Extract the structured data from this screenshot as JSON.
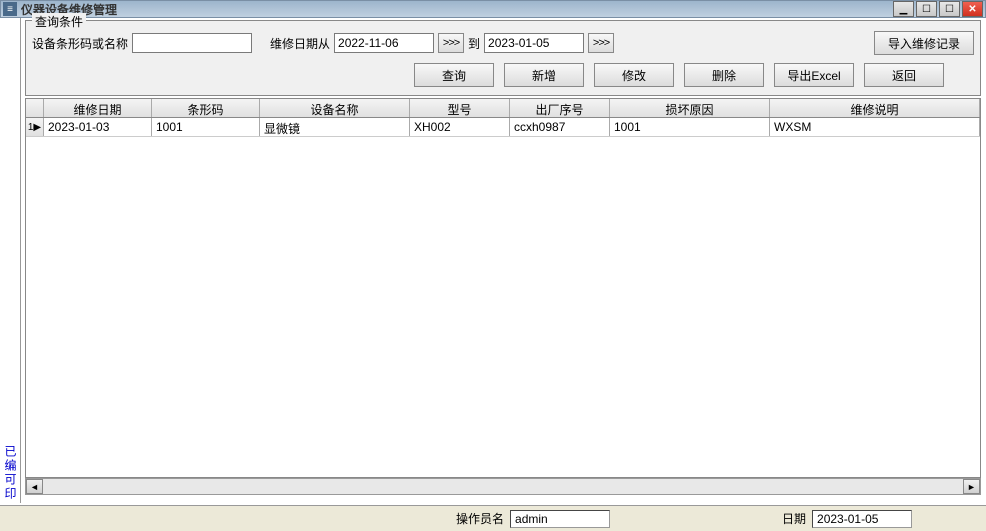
{
  "window": {
    "title": "仪器设备维修管理"
  },
  "query": {
    "legend": "查询条件",
    "barcode_label": "设备条形码或名称",
    "barcode_value": "",
    "date_from_label": "维修日期从",
    "date_from_value": "2022-11-06",
    "date_to_label": "到",
    "date_to_value": "2023-01-05",
    "picker_btn": ">>>",
    "import_btn": "导入维修记录"
  },
  "buttons": {
    "query": "查询",
    "add": "新增",
    "edit": "修改",
    "delete": "删除",
    "export": "导出Excel",
    "back": "返回"
  },
  "grid": {
    "row_num": "1",
    "row_marker": "▶",
    "headers": {
      "date": "维修日期",
      "barcode": "条形码",
      "name": "设备名称",
      "model": "型号",
      "serial": "出厂序号",
      "reason": "损坏原因",
      "desc": "维修说明"
    },
    "rows": [
      {
        "date": "2023-01-03",
        "barcode": "1001",
        "name": "显微镜",
        "model": "XH002",
        "serial": "ccxh0987",
        "reason": "1001",
        "desc": "WXSM"
      }
    ]
  },
  "status": {
    "operator_label": "操作员名",
    "operator_value": "admin",
    "date_label": "日期",
    "date_value": "2023-01-05"
  },
  "sidebar": {
    "text": "已编可印"
  }
}
